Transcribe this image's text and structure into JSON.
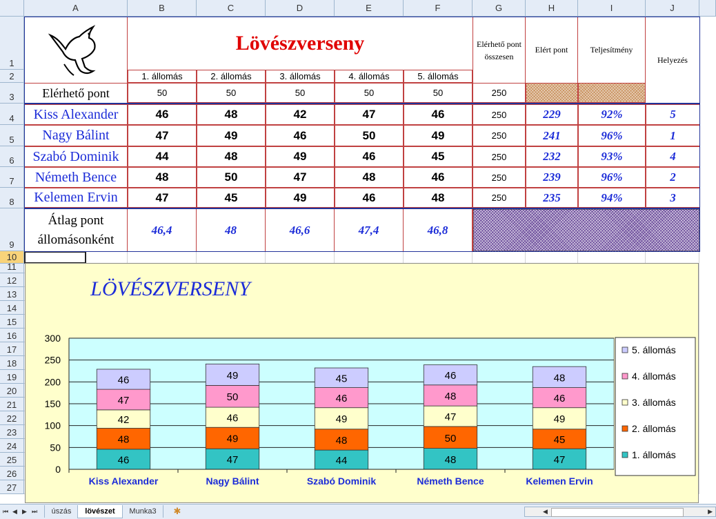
{
  "columns": [
    "A",
    "B",
    "C",
    "D",
    "E",
    "F",
    "G",
    "H",
    "I",
    "J"
  ],
  "rows": [
    "1",
    "2",
    "3",
    "4",
    "5",
    "6",
    "7",
    "8",
    "9",
    "10",
    "11",
    "12",
    "13",
    "14",
    "15",
    "16",
    "17",
    "18",
    "19",
    "20",
    "21",
    "22",
    "23",
    "24",
    "25",
    "26",
    "27"
  ],
  "sheet": {
    "title": "Lövészverseny",
    "stations": [
      "1. állomás",
      "2. állomás",
      "3. állomás",
      "4. állomás",
      "5. állomás"
    ],
    "hdr_total": "Elérhető pont összesen",
    "hdr_achieved": "Elért pont",
    "hdr_perf": "Teljesítmény",
    "hdr_rank": "Helyezés",
    "max_label": "Elérhető pont",
    "max_values": [
      "50",
      "50",
      "50",
      "50",
      "50",
      "250"
    ],
    "players": [
      {
        "name": "Kiss Alexander",
        "scores": [
          "46",
          "48",
          "42",
          "47",
          "46"
        ],
        "total": "250",
        "achieved": "229",
        "perf": "92%",
        "rank": "5"
      },
      {
        "name": "Nagy Bálint",
        "scores": [
          "47",
          "49",
          "46",
          "50",
          "49"
        ],
        "total": "250",
        "achieved": "241",
        "perf": "96%",
        "rank": "1"
      },
      {
        "name": "Szabó Dominik",
        "scores": [
          "44",
          "48",
          "49",
          "46",
          "45"
        ],
        "total": "250",
        "achieved": "232",
        "perf": "93%",
        "rank": "4"
      },
      {
        "name": "Németh Bence",
        "scores": [
          "48",
          "50",
          "47",
          "48",
          "46"
        ],
        "total": "250",
        "achieved": "239",
        "perf": "96%",
        "rank": "2"
      },
      {
        "name": "Kelemen Ervin",
        "scores": [
          "47",
          "45",
          "49",
          "46",
          "48"
        ],
        "total": "250",
        "achieved": "235",
        "perf": "94%",
        "rank": "3"
      }
    ],
    "avg_label_1": "Átlag pont",
    "avg_label_2": "állomásonként",
    "averages": [
      "46,4",
      "48",
      "46,6",
      "47,4",
      "46,8"
    ]
  },
  "chart_data": {
    "type": "bar",
    "stacked": true,
    "title": "LÖVÉSZVERSENY",
    "categories": [
      "Kiss Alexander",
      "Nagy Bálint",
      "Szabó Dominik",
      "Németh Bence",
      "Kelemen Ervin"
    ],
    "ylim": [
      0,
      300
    ],
    "yticks": [
      "0",
      "50",
      "100",
      "150",
      "200",
      "250",
      "300"
    ],
    "grid": true,
    "legend_position": "right",
    "series": [
      {
        "name": "1. állomás",
        "values": [
          46,
          47,
          44,
          48,
          47
        ],
        "color": "#33c4c4"
      },
      {
        "name": "2. állomás",
        "values": [
          48,
          49,
          48,
          50,
          45
        ],
        "color": "#ff6600"
      },
      {
        "name": "3. állomás",
        "values": [
          42,
          46,
          49,
          47,
          49
        ],
        "color": "#ffffcc"
      },
      {
        "name": "4. állomás",
        "values": [
          47,
          50,
          46,
          48,
          46
        ],
        "color": "#ff99cc"
      },
      {
        "name": "5. állomás",
        "values": [
          46,
          49,
          45,
          46,
          48
        ],
        "color": "#ccccff"
      }
    ],
    "plot_bg": "#ccffff",
    "chart_bg": "#ffffcc"
  },
  "tabs": [
    "úszás",
    "lövészet",
    "Munka3"
  ],
  "active_tab": "lövészet",
  "colors": {
    "accent_blue": "#1c2cd8",
    "title_red": "#e00000",
    "header_bg": "#e4ecf7"
  }
}
